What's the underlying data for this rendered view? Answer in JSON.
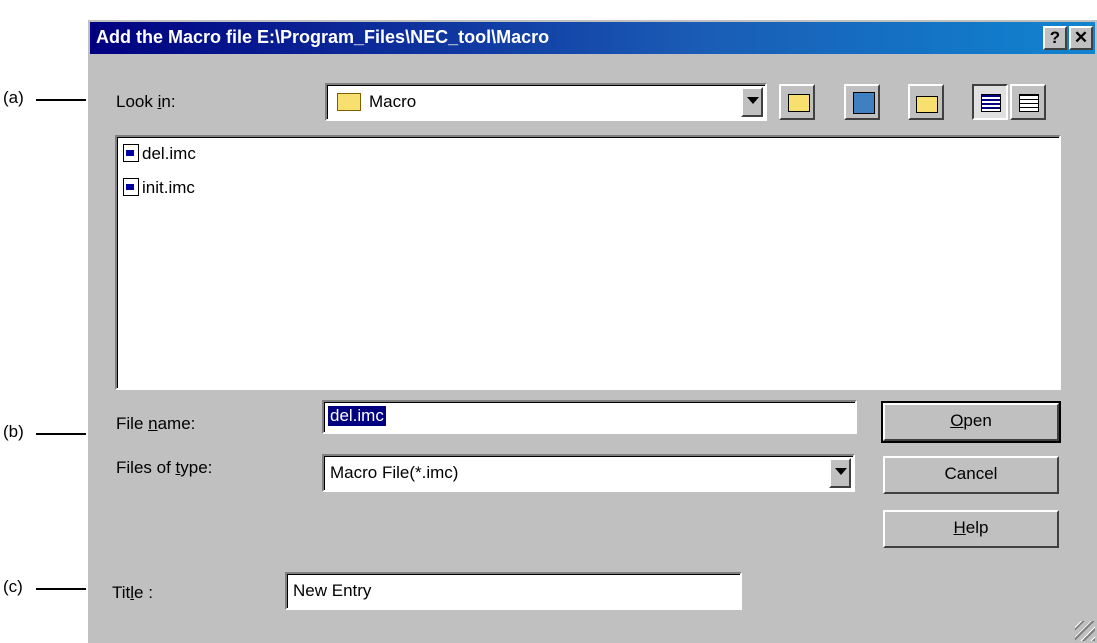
{
  "annotations": {
    "a": "(a)",
    "b": "(b)",
    "c": "(c)"
  },
  "window": {
    "title": "Add the Macro file E:\\Program_Files\\NEC_tool\\Macro",
    "help_btn": "?",
    "close_btn": "✕"
  },
  "look_in": {
    "label_pre": "Look ",
    "label_u": "i",
    "label_post": "n:",
    "value": "Macro"
  },
  "toolbar": {
    "icons": [
      "up-folder-icon",
      "desktop-icon",
      "new-folder-icon",
      "list-view-icon",
      "details-view-icon"
    ]
  },
  "files": [
    {
      "name": "del.imc"
    },
    {
      "name": "init.imc"
    }
  ],
  "file_name": {
    "label_pre": "File ",
    "label_u": "n",
    "label_post": "ame:",
    "value": "del.imc"
  },
  "files_of_type": {
    "label_pre": "Files of ",
    "label_u": "t",
    "label_post": "ype:",
    "value": "Macro File(*.imc)"
  },
  "buttons": {
    "open_u": "O",
    "open_rest": "pen",
    "cancel": "Cancel",
    "help_u": "H",
    "help_rest": "elp"
  },
  "title_field": {
    "label_pre": "Tit",
    "label_u": "l",
    "label_post": "e :",
    "value": "New Entry"
  },
  "colors": {
    "titlebar": "#000080",
    "dialog_bg": "#c0c0c0",
    "selection": "#000080"
  }
}
